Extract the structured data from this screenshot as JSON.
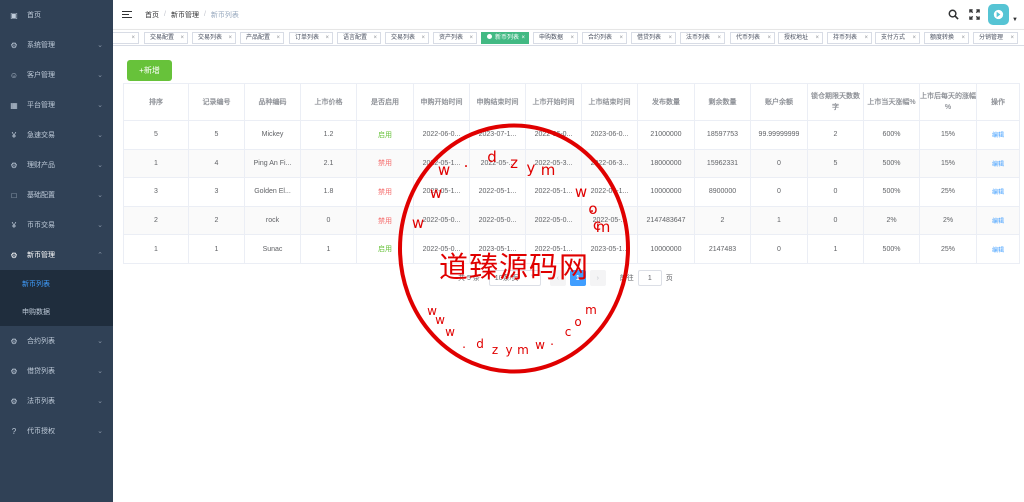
{
  "sidebar": {
    "items": [
      {
        "icon": "dashboard-icon",
        "glyph": "▣",
        "label": "首页",
        "has_children": false
      },
      {
        "icon": "gear-icon",
        "glyph": "⚙",
        "label": "系统管理",
        "has_children": true
      },
      {
        "icon": "user-icon",
        "glyph": "☺",
        "label": "客户管理",
        "has_children": true
      },
      {
        "icon": "grid-icon",
        "glyph": "▦",
        "label": "平台管理",
        "has_children": true
      },
      {
        "icon": "yen-icon",
        "glyph": "¥",
        "label": "急速交易",
        "has_children": true
      },
      {
        "icon": "circle-gear-icon",
        "glyph": "⚙",
        "label": "理财产品",
        "has_children": true
      },
      {
        "icon": "book-icon",
        "glyph": "□",
        "label": "基础配置",
        "has_children": true
      },
      {
        "icon": "yen-icon",
        "glyph": "¥",
        "label": "币币交易",
        "has_children": true
      },
      {
        "icon": "circle-gear-icon",
        "glyph": "⚙",
        "label": "新币管理",
        "has_children": true,
        "open": true
      }
    ],
    "submenu": [
      {
        "label": "新币列表",
        "active": true
      },
      {
        "label": "申购数据",
        "active": false
      }
    ],
    "items_after": [
      {
        "icon": "circle-gear-icon",
        "glyph": "⚙",
        "label": "合约列表",
        "has_children": true
      },
      {
        "icon": "circle-gear-icon",
        "glyph": "⚙",
        "label": "借贷列表",
        "has_children": true
      },
      {
        "icon": "circle-gear-icon",
        "glyph": "⚙",
        "label": "法币列表",
        "has_children": true
      },
      {
        "icon": "question-icon",
        "glyph": "?",
        "label": "代币授权",
        "has_children": true
      }
    ]
  },
  "navbar": {
    "breadcrumb": [
      "首页",
      "新币管理",
      "新币列表"
    ]
  },
  "tags": [
    {
      "label": "列表",
      "active": false
    },
    {
      "label": "交易配置",
      "active": false
    },
    {
      "label": "交易列表",
      "active": false
    },
    {
      "label": "产品配置",
      "active": false
    },
    {
      "label": "订单列表",
      "active": false
    },
    {
      "label": "语言配置",
      "active": false
    },
    {
      "label": "交易列表",
      "active": false
    },
    {
      "label": "资产列表",
      "active": false
    },
    {
      "label": "新币列表",
      "active": true
    },
    {
      "label": "申购数据",
      "active": false
    },
    {
      "label": "合约列表",
      "active": false
    },
    {
      "label": "借贷列表",
      "active": false
    },
    {
      "label": "法币列表",
      "active": false
    },
    {
      "label": "代币列表",
      "active": false
    },
    {
      "label": "授权地址",
      "active": false
    },
    {
      "label": "持币列表",
      "active": false
    },
    {
      "label": "支付方式",
      "active": false
    },
    {
      "label": "额度转换",
      "active": false
    },
    {
      "label": "分销管理",
      "active": false
    }
  ],
  "main": {
    "add_button": "+新增",
    "columns": [
      "排序",
      "记录编号",
      "品种编码",
      "上市价格",
      "是否启用",
      "申购开始时间",
      "申购结束时间",
      "上市开始时间",
      "上市结束时间",
      "发布数量",
      "剩余数量",
      "账户余额",
      "锁仓期限天数数字",
      "上市当天涨幅%",
      "上市后每天的涨幅 %",
      "操作"
    ],
    "rows": [
      [
        "5",
        "5",
        "Mickey",
        "1.2",
        "启用",
        "2022-06-0...",
        "2023-07-1...",
        "2022-06-0...",
        "2023-06-0...",
        "21000000",
        "18597753",
        "99.99999999",
        "2",
        "600%",
        "15%",
        "编辑"
      ],
      [
        "1",
        "4",
        "Ping An Fi...",
        "2.1",
        "禁用",
        "2022-05-1...",
        "2022-05-...",
        "2022-05-3...",
        "2022-06-3...",
        "18000000",
        "15962331",
        "0",
        "5",
        "500%",
        "15%",
        "编辑"
      ],
      [
        "3",
        "3",
        "Golden El...",
        "1.8",
        "禁用",
        "2022-05-1...",
        "2022-05-1...",
        "2022-05-1...",
        "2022-05-1...",
        "10000000",
        "8900000",
        "0",
        "0",
        "500%",
        "25%",
        "编辑"
      ],
      [
        "2",
        "2",
        "rock",
        "0",
        "禁用",
        "2022-05-0...",
        "2022-05-0...",
        "2022-05-0...",
        "2022-05-...",
        "2147483647",
        "2",
        "1",
        "0",
        "2%",
        "2%",
        "编辑"
      ],
      [
        "1",
        "1",
        "Sunac",
        "1",
        "启用",
        "2022-05-0...",
        "2023-05-1...",
        "2022-05-1...",
        "2023-05-1...",
        "10000000",
        "2147483",
        "0",
        "1",
        "500%",
        "25%",
        "编辑"
      ]
    ],
    "pagination": {
      "total": "共 5 条",
      "page_size": "10条/页",
      "current_page": "1",
      "goto_label": "前往",
      "goto_value": "1",
      "page_suffix": "页"
    }
  },
  "watermark": {
    "title": "道臻源码网",
    "ring_chars": [
      "w",
      "w",
      "w",
      ".",
      "d",
      "z",
      "y",
      "m",
      "w",
      ".",
      "c",
      "o",
      "m"
    ],
    "inner_chars": [
      "w",
      "w",
      "w",
      ".",
      "d",
      "z",
      "y",
      "m",
      "w",
      ".",
      "c",
      "o",
      "m"
    ]
  },
  "colors": {
    "sidebar_bg": "#304156",
    "submenu_bg": "#1f2d3d",
    "active_tag": "#42b983",
    "add_button": "#67c23a",
    "primary": "#409eff",
    "enabled": "#67c23a",
    "disabled": "#f56c6c",
    "watermark": "#e00000"
  }
}
